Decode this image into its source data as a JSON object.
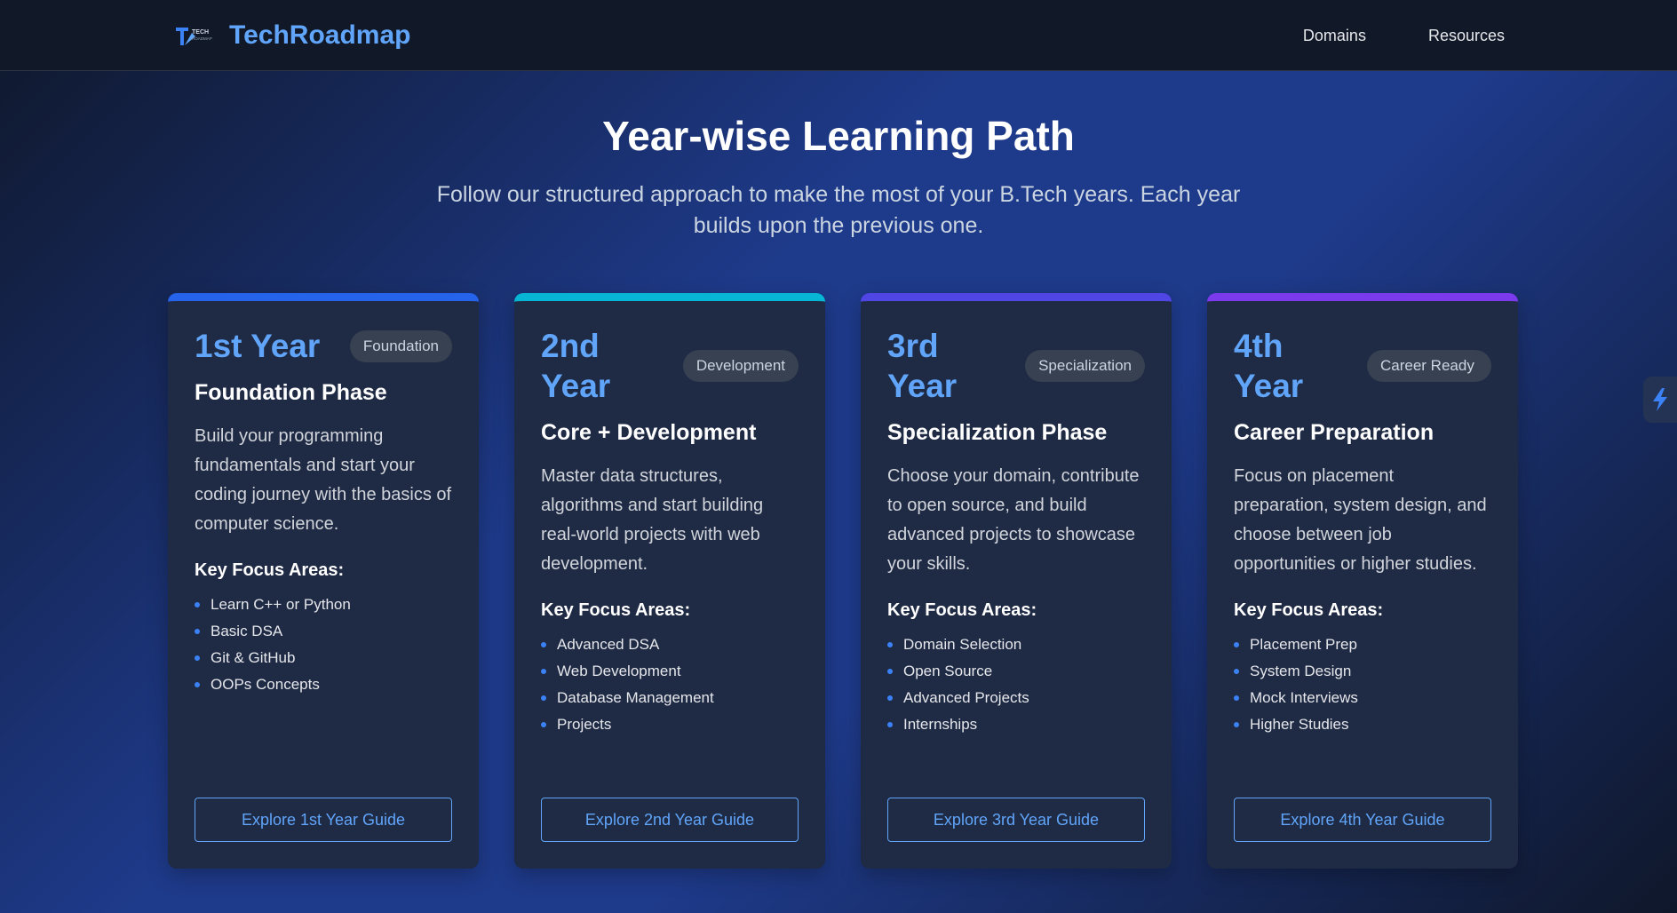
{
  "brand": {
    "name": "TechRoadmap",
    "logo_text": "TECH ROADMAP",
    "logo_icon": "tech-roadmap-logo"
  },
  "nav": {
    "links": [
      "Domains",
      "Resources"
    ]
  },
  "hero": {
    "title": "Year-wise Learning Path",
    "subtitle": "Follow our structured approach to make the most of your B.Tech years. Each year builds upon the previous one."
  },
  "cards": [
    {
      "year": "1st Year",
      "badge": "Foundation",
      "phase": "Foundation Phase",
      "description": "Build your programming fundamentals and start your coding journey with the basics of computer science.",
      "focus_title": "Key Focus Areas:",
      "focus_items": [
        "Learn C++ or Python",
        "Basic DSA",
        "Git & GitHub",
        "OOPs Concepts"
      ],
      "button": "Explore 1st Year Guide",
      "accent": "#2563eb"
    },
    {
      "year": "2nd Year",
      "badge": "Development",
      "phase": "Core + Development",
      "description": "Master data structures, algorithms and start building real-world projects with web development.",
      "focus_title": "Key Focus Areas:",
      "focus_items": [
        "Advanced DSA",
        "Web Development",
        "Database Management",
        "Projects"
      ],
      "button": "Explore 2nd Year Guide",
      "accent": "#06b6d4"
    },
    {
      "year": "3rd Year",
      "badge": "Specialization",
      "phase": "Specialization Phase",
      "description": "Choose your domain, contribute to open source, and build advanced projects to showcase your skills.",
      "focus_title": "Key Focus Areas:",
      "focus_items": [
        "Domain Selection",
        "Open Source",
        "Advanced Projects",
        "Internships"
      ],
      "button": "Explore 3rd Year Guide",
      "accent": "#4f46e5"
    },
    {
      "year": "4th Year",
      "badge": "Career Ready",
      "phase": "Career Preparation",
      "description": "Focus on placement preparation, system design, and choose between job opportunities or higher studies.",
      "focus_title": "Key Focus Areas:",
      "focus_items": [
        "Placement Prep",
        "System Design",
        "Mock Interviews",
        "Higher Studies"
      ],
      "button": "Explore 4th Year Guide",
      "accent": "#7c3aed"
    }
  ],
  "side_widget": {
    "icon": "lightning-icon"
  }
}
